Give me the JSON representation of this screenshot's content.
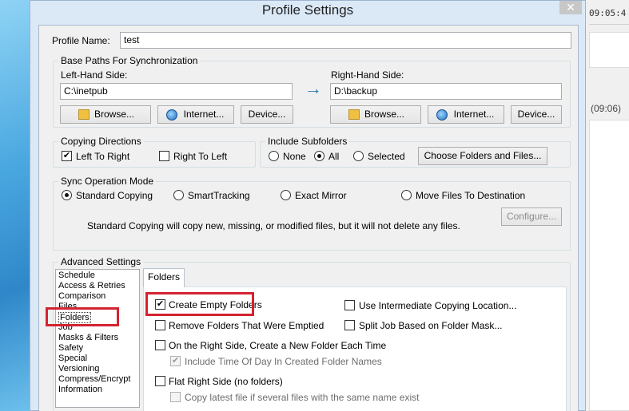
{
  "dialog": {
    "title": "Profile Settings",
    "close_label": "✕"
  },
  "background_window": {
    "clock": "09:05:4",
    "time_entry": "(09:06)"
  },
  "profile": {
    "name_label": "Profile Name:",
    "name_value": "test"
  },
  "base_paths": {
    "group_title": "Base Paths For Synchronization",
    "left": {
      "label": "Left-Hand Side:",
      "value": "C:\\inetpub",
      "browse": "Browse...",
      "internet": "Internet...",
      "device": "Device..."
    },
    "arrow": "→",
    "right": {
      "label": "Right-Hand Side:",
      "value": "D:\\backup",
      "browse": "Browse...",
      "internet": "Internet...",
      "device": "Device..."
    }
  },
  "copying_directions": {
    "group_title": "Copying Directions",
    "left_to_right": "Left To Right",
    "left_to_right_checked": true,
    "right_to_left": "Right To Left",
    "right_to_left_checked": false
  },
  "include_subfolders": {
    "group_title": "Include Subfolders",
    "options": [
      "None",
      "All",
      "Selected"
    ],
    "selected": "All",
    "choose_button": "Choose Folders and Files..."
  },
  "sync_mode": {
    "group_title": "Sync Operation Mode",
    "options": [
      "Standard Copying",
      "SmartTracking",
      "Exact Mirror",
      "Move Files To Destination"
    ],
    "selected": "Standard Copying",
    "configure_button": "Configure...",
    "description": "Standard Copying will copy new, missing, or modified files, but it will not delete any files."
  },
  "advanced": {
    "group_title": "Advanced Settings",
    "categories": [
      "Schedule",
      "Access & Retries",
      "Comparison",
      "Files",
      "Folders",
      "Job",
      "Masks & Filters",
      "Safety",
      "Special",
      "Versioning",
      "Compress/Encrypt",
      "Information"
    ],
    "selected_category": "Folders",
    "tab_label": "Folders",
    "options": {
      "create_empty_folders": "Create Empty Folders",
      "remove_folders_emptied": "Remove Folders That Were Emptied",
      "right_side_new_folder": "On the Right Side, Create a New Folder Each Time",
      "include_time_of_day": "Include Time Of Day In Created Folder Names",
      "flat_right_side": "Flat Right Side (no folders)",
      "copy_latest_file": "Copy latest file if several files with the same name exist",
      "use_intermediate": "Use Intermediate Copying Location...",
      "split_job": "Split Job Based on Folder Mask..."
    },
    "checked": {
      "create_empty_folders": true,
      "remove_folders_emptied": false,
      "right_side_new_folder": false,
      "include_time_of_day": true,
      "flat_right_side": false,
      "copy_latest_file": false,
      "use_intermediate": false,
      "split_job": false
    }
  },
  "colors": {
    "highlight_box": "#d32330",
    "arrow": "#2a7ab0"
  },
  "check_glyph": "✔"
}
